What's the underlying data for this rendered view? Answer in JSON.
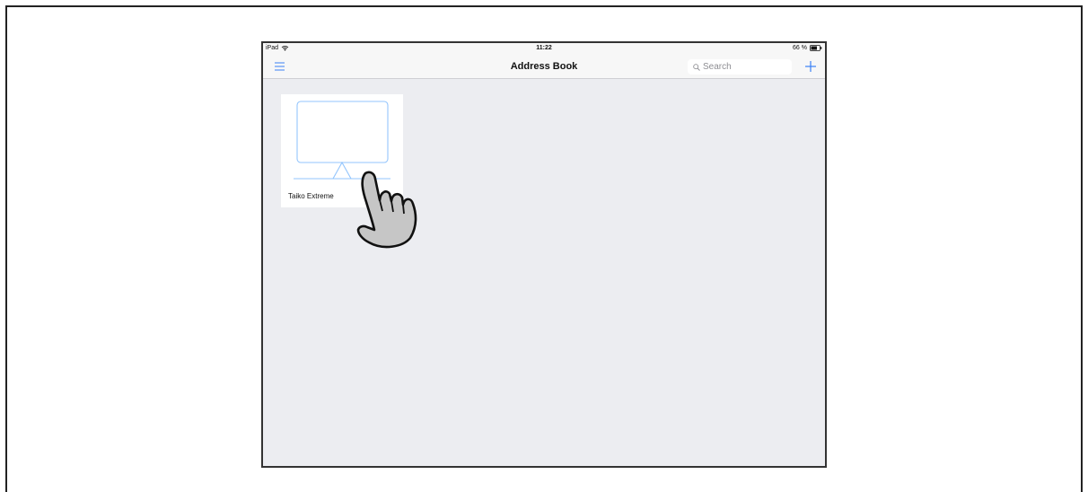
{
  "status_bar": {
    "device": "iPad",
    "time": "11:22",
    "battery": "66 %"
  },
  "nav_bar": {
    "title": "Address Book",
    "menu_icon": "hamburger-menu-icon",
    "add_icon": "plus-icon"
  },
  "search": {
    "placeholder": "Search",
    "value": ""
  },
  "devices": [
    {
      "name": "Taiko Extreme",
      "icon": "monitor-icon"
    }
  ],
  "colors": {
    "accent": "#3b82f6",
    "background": "#ecedf1",
    "bar": "#f7f7f7"
  }
}
